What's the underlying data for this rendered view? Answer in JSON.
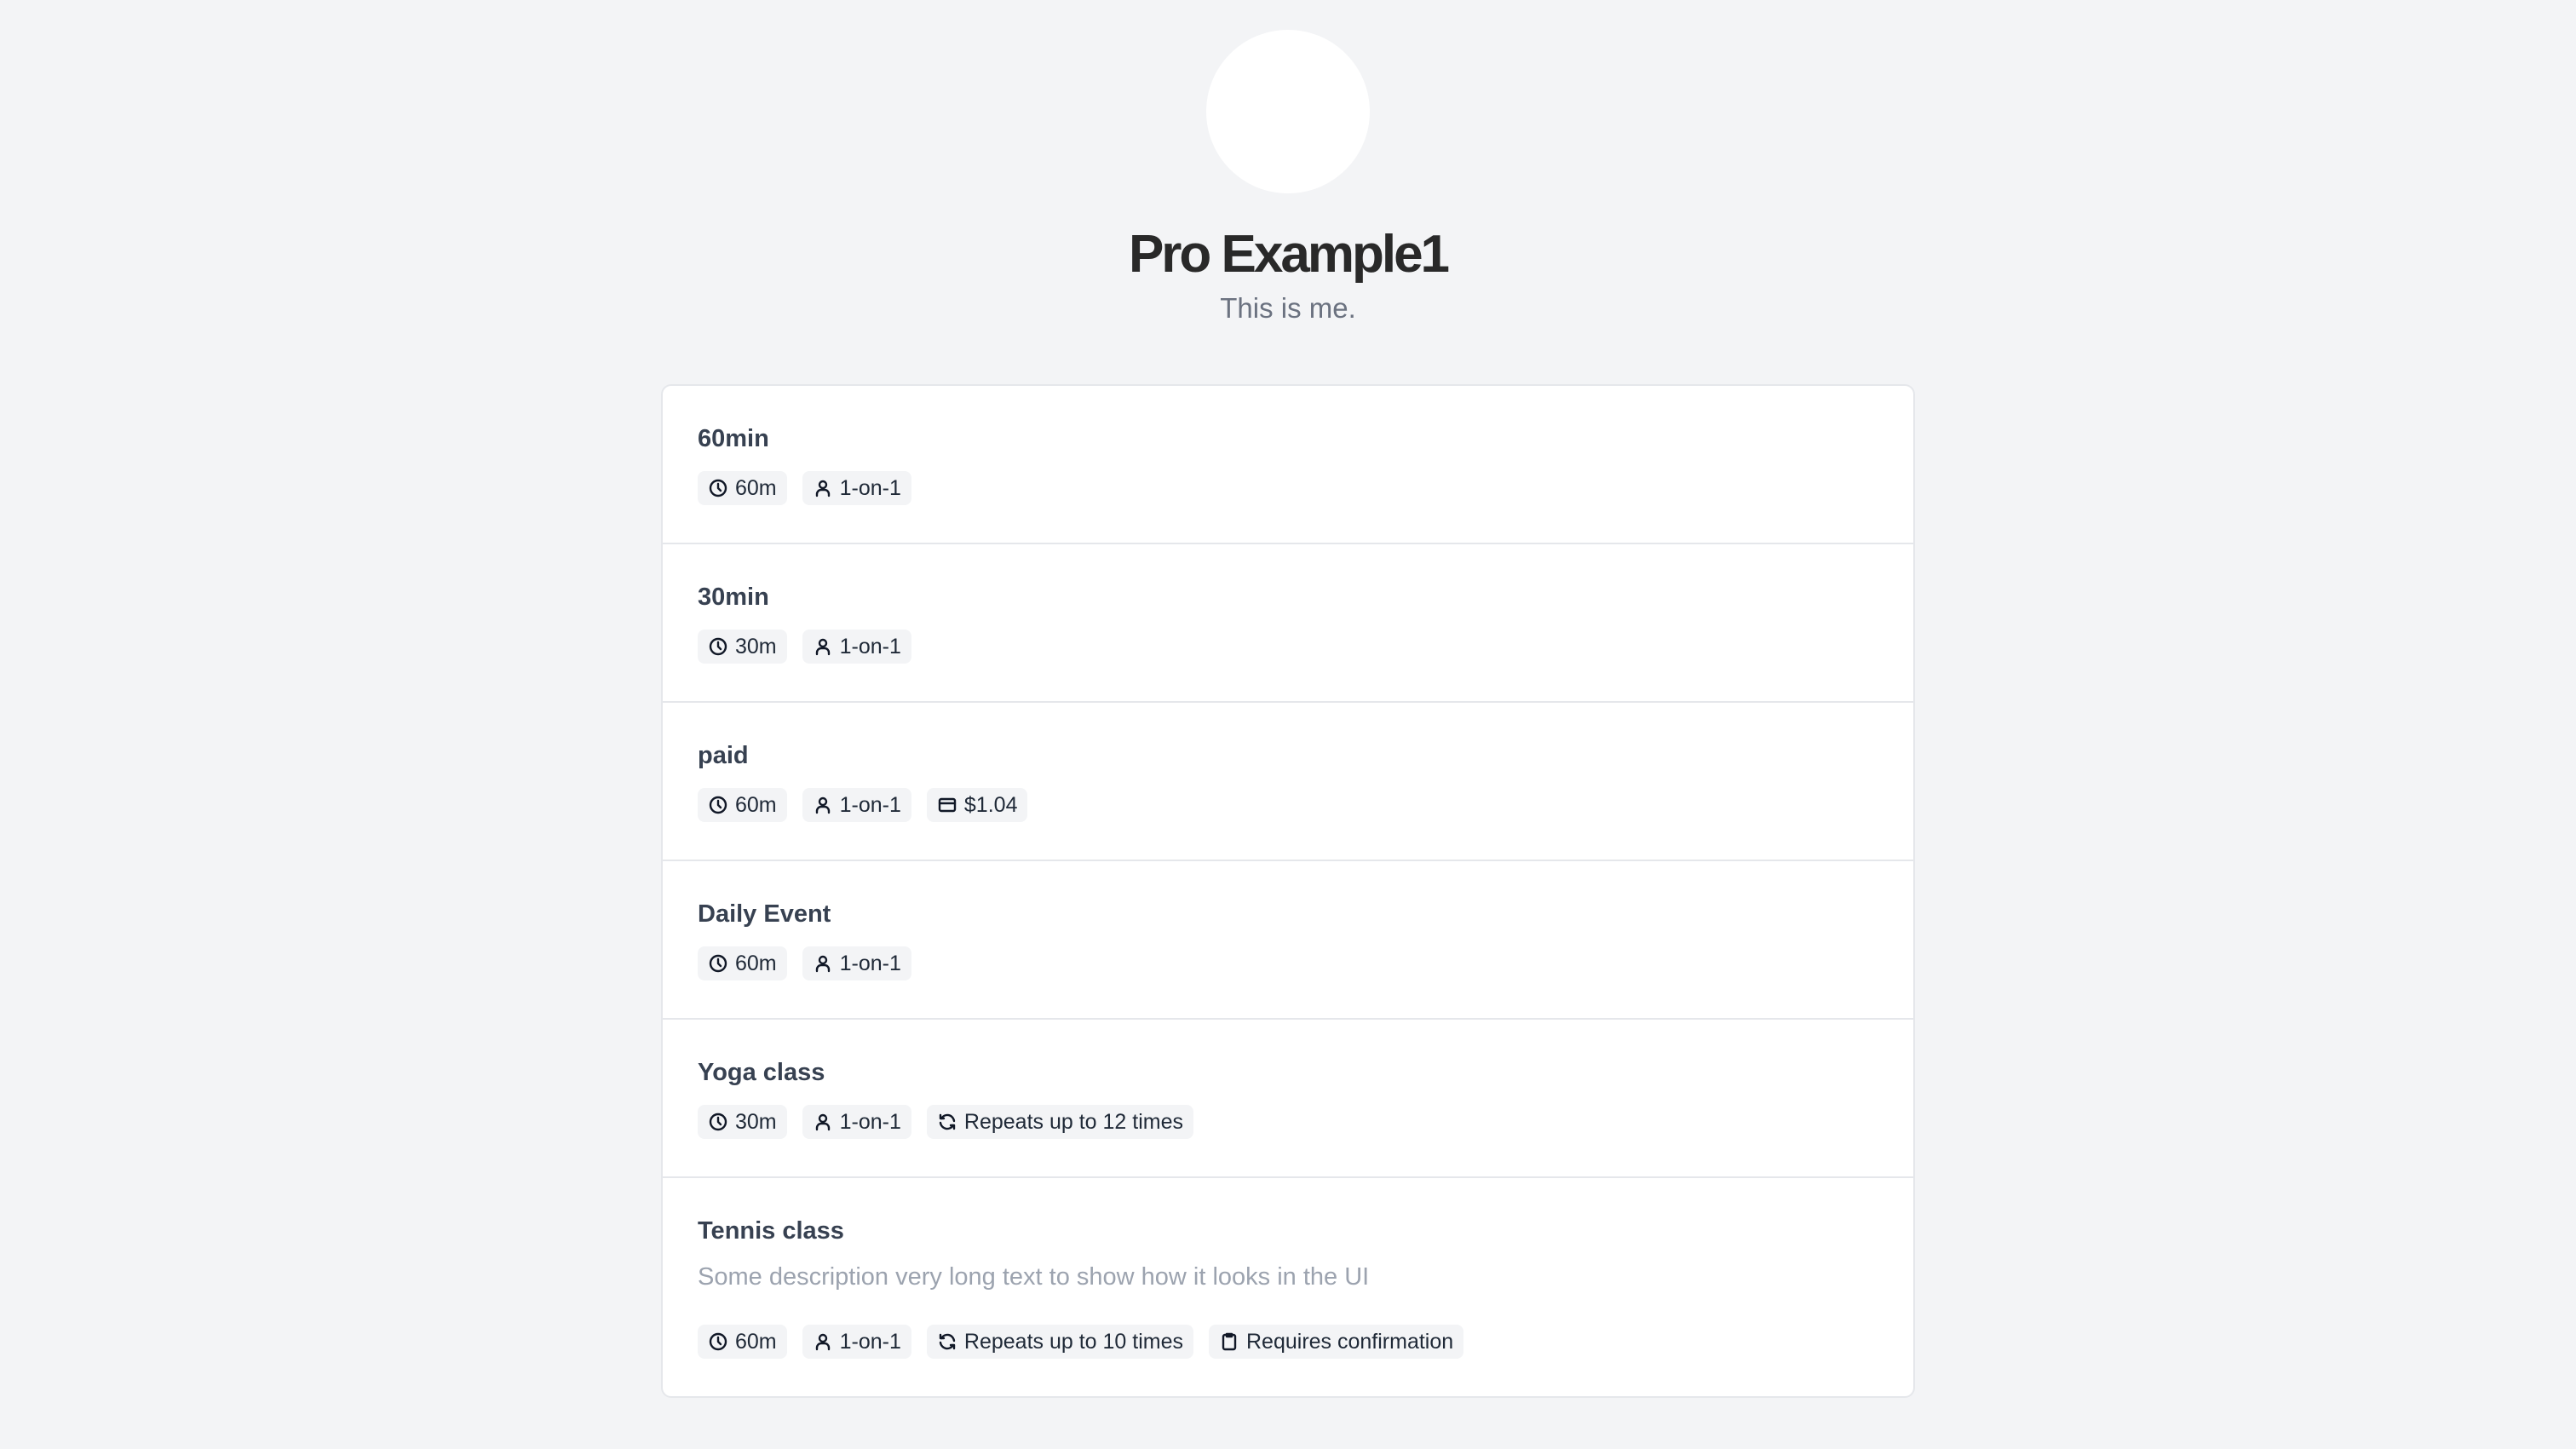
{
  "profile": {
    "name": "Pro Example1",
    "bio": "This is me."
  },
  "events": [
    {
      "title": "60min",
      "badges": [
        {
          "icon": "clock-icon",
          "text": "60m"
        },
        {
          "icon": "user-icon",
          "text": "1-on-1"
        }
      ]
    },
    {
      "title": "30min",
      "badges": [
        {
          "icon": "clock-icon",
          "text": "30m"
        },
        {
          "icon": "user-icon",
          "text": "1-on-1"
        }
      ]
    },
    {
      "title": "paid",
      "badges": [
        {
          "icon": "clock-icon",
          "text": "60m"
        },
        {
          "icon": "user-icon",
          "text": "1-on-1"
        },
        {
          "icon": "credit-card-icon",
          "text": "$1.04"
        }
      ]
    },
    {
      "title": "Daily Event",
      "badges": [
        {
          "icon": "clock-icon",
          "text": "60m"
        },
        {
          "icon": "user-icon",
          "text": "1-on-1"
        }
      ]
    },
    {
      "title": "Yoga class",
      "badges": [
        {
          "icon": "clock-icon",
          "text": "30m"
        },
        {
          "icon": "user-icon",
          "text": "1-on-1"
        },
        {
          "icon": "refresh-icon",
          "text": "Repeats up to 12 times"
        }
      ]
    },
    {
      "title": "Tennis class",
      "description": "Some description very long text to show how it looks in the UI",
      "badges": [
        {
          "icon": "clock-icon",
          "text": "60m"
        },
        {
          "icon": "user-icon",
          "text": "1-on-1"
        },
        {
          "icon": "refresh-icon",
          "text": "Repeats up to 10 times"
        },
        {
          "icon": "clipboard-icon",
          "text": "Requires confirmation"
        }
      ]
    }
  ]
}
